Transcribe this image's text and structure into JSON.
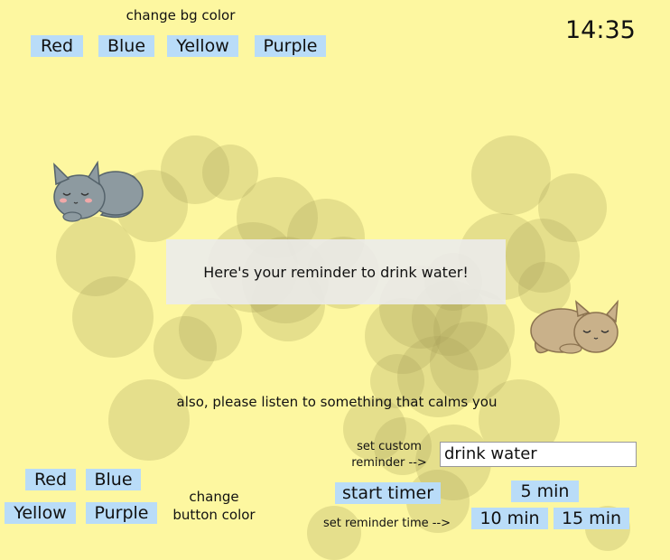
{
  "clock": "14:35",
  "bg_color": {
    "label": "change bg color",
    "buttons": [
      "Red",
      "Blue",
      "Yellow",
      "Purple"
    ]
  },
  "reminder": {
    "message": "Here's your reminder to drink water!"
  },
  "calm_message": "also, please listen to something that calms you",
  "custom_reminder": {
    "label_line1": "set custom",
    "label_line2": "reminder -->",
    "value": "drink water"
  },
  "timer": {
    "start_label": "start timer",
    "set_time_label": "set reminder time -->",
    "options": [
      "5 min",
      "10 min",
      "15 min"
    ]
  },
  "button_color": {
    "label_line1": "change",
    "label_line2": "button color",
    "buttons": [
      "Red",
      "Blue",
      "Yellow",
      "Purple"
    ]
  },
  "colors": {
    "background": "#fdf7a0",
    "button": "#b9dcf8",
    "bubble": "#aaa05a",
    "reminder_box": "#ebebeb",
    "grey_cat": "#8d9aa0",
    "tan_cat": "#c9b18a"
  }
}
